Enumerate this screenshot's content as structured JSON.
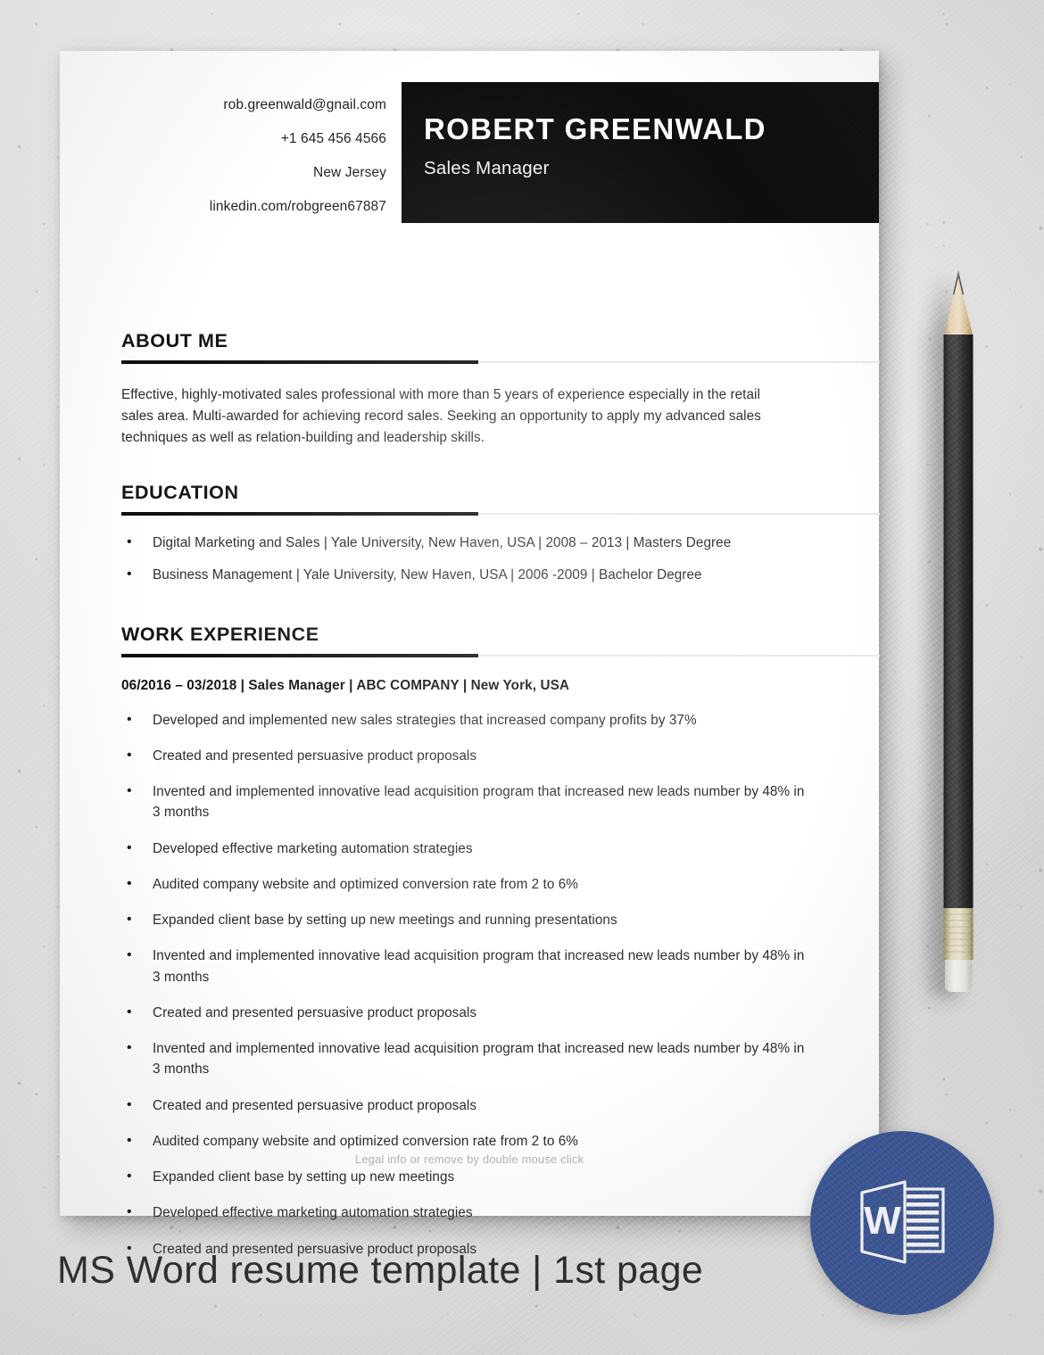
{
  "caption": "MS Word resume template | 1st page",
  "colors": {
    "banner_bg": "#0d0d0d",
    "word_badge_blue": "#3a5596",
    "rule_black": "#0d0d0d",
    "rule_gray": "#e9e9e9",
    "page_white": "#ffffff"
  },
  "resume": {
    "header": {
      "name": "ROBERT GREENWALD",
      "job_title": "Sales Manager",
      "contacts": [
        {
          "icon": "envelope-icon",
          "value": "rob.greenwald@gnail.com"
        },
        {
          "icon": "phone-icon",
          "value": "+1 645 456 4566"
        },
        {
          "icon": "location-pin-icon",
          "value": "New Jersey"
        },
        {
          "icon": "linkedin-icon",
          "value": "linkedin.com/robgreen67887"
        }
      ]
    },
    "sections": {
      "about": {
        "title": "ABOUT ME",
        "text": "Effective, highly-motivated  sales professional with more than 5 years of experience especially in the retail sales area. Multi-awarded for achieving record sales. Seeking an opportunity to apply my advanced sales techniques as well as relation-building  and leadership skills."
      },
      "education": {
        "title": "EDUCATION",
        "items": [
          "Digital Marketing and Sales | Yale University, New Haven, USA | 2008 – 2013 | Masters Degree",
          "Business Management | Yale University, New Haven, USA | 2006 -2009 | Bachelor Degree"
        ]
      },
      "work": {
        "title": "WORK EXPERIENCE",
        "job_line": "06/2016 – 03/2018 | Sales Manager | ABC COMPANY | New York, USA",
        "items": [
          "Developed and implemented new sales strategies that increased company profits by 37%",
          "Created and presented persuasive product proposals",
          "Invented and implemented innovative lead acquisition program that increased new leads number by 48% in 3 months",
          "Developed effective marketing automation strategies",
          "Audited company website and optimized conversion rate from 2 to 6%",
          "Expanded client base by setting up new meetings and running presentations",
          "Invented and implemented innovative lead acquisition program that increased new leads number by 48% in 3 months",
          "Created and presented persuasive product proposals",
          "Invented and implemented innovative lead acquisition program that increased new leads number by 48% in 3 months",
          "Created and presented persuasive product proposals",
          "Audited company website and optimized conversion rate from 2 to 6%",
          "Expanded client base by setting up new meetings",
          "Developed effective marketing automation strategies",
          "Created and presented persuasive product proposals"
        ]
      }
    },
    "legal_note": "Legal info or remove by double mouse click"
  }
}
